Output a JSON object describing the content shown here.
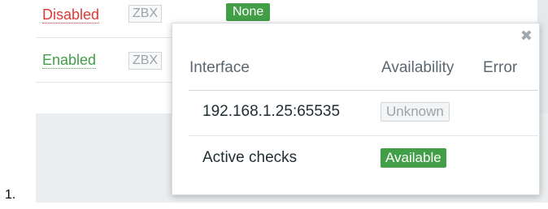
{
  "list_marker": "1.",
  "background_rows": [
    {
      "status": "Disabled",
      "agent": "ZBX",
      "badge": "None"
    },
    {
      "status": "Enabled",
      "agent": "ZBX"
    }
  ],
  "popup": {
    "close_icon": "close-icon",
    "columns": [
      "Interface",
      "Availability",
      "Error"
    ],
    "rows": [
      {
        "interface": "192.168.1.25:65535",
        "availability": "Unknown",
        "error": ""
      },
      {
        "interface": "Active checks",
        "availability": "Available",
        "error": ""
      }
    ]
  },
  "colors": {
    "disabled": "#e33734",
    "enabled": "#429e47",
    "available": "#429e47",
    "unknown_text": "#9aa4ab"
  }
}
